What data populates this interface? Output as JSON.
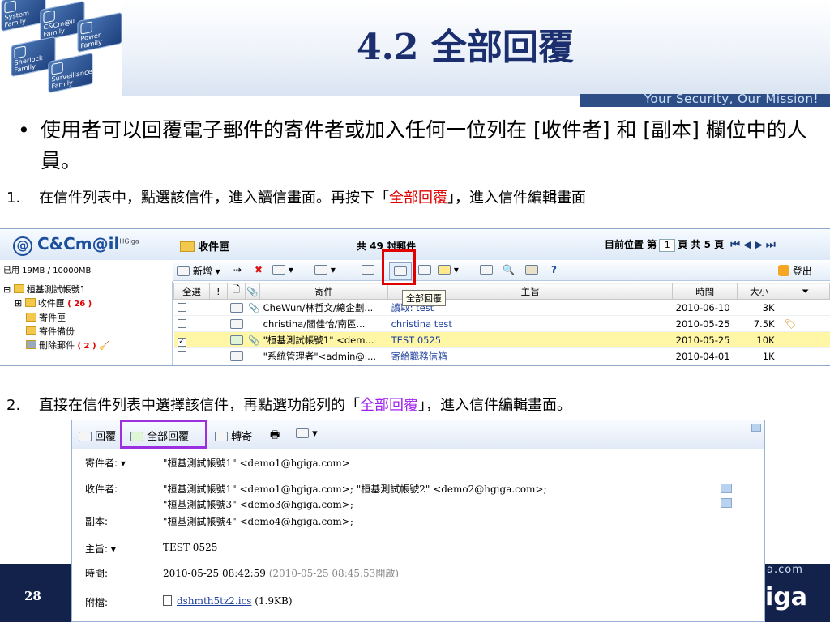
{
  "slide": {
    "title": "4.2 全部回覆",
    "slogan": "Your Security, Our Mission!",
    "bullet": "使用者可以回覆電子郵件的寄件者或加入任何一位列在 [收件者] 和 [副本] 欄位中的人員。",
    "step1": {
      "num": "1.",
      "pre": "在信件列表中，點選該信件，進入讀信畫面。再按下「",
      "accent": "全部回覆",
      "post": "」，進入信件編輯畫面"
    },
    "step2": {
      "num": "2.",
      "pre": "直接在信件列表中選擇該信件，再點選功能列的「",
      "accent": "全部回覆",
      "post": "」，進入信件編輯畫面。"
    },
    "page_number": "28",
    "footer_domain": "a.com",
    "footer_brand": "iga",
    "logo_tiles": [
      "System Family",
      "C&Cm@il Family",
      "Power Family",
      "Sherlock Family",
      "Surveillance Family"
    ]
  },
  "mail_list": {
    "brand": "C&Cm@il",
    "brand_sup": "HGiga",
    "folder": "收件匣",
    "count": "共 49 封郵件",
    "pager": {
      "label": "目前位置 第",
      "page": "1",
      "unit": "頁",
      "total": "共 5 頁"
    },
    "quota": "已用 19MB / 10000MB",
    "toolbar": {
      "new": "新增",
      "logout": "登出",
      "tooltip": "全部回覆"
    },
    "tree": [
      {
        "label": "桓基測試帳號1",
        "count": ""
      },
      {
        "label": "收件匣",
        "count": "( 26 )"
      },
      {
        "label": "寄件匣",
        "count": ""
      },
      {
        "label": "寄件備份",
        "count": ""
      },
      {
        "label": "刪除郵件",
        "count": "( 2 )"
      }
    ],
    "columns": {
      "select_all": "全選",
      "flag": "!",
      "sender": "寄件",
      "subject": "主旨",
      "time": "時間",
      "size": "大小"
    },
    "rows": [
      {
        "checked": false,
        "sender": "CheWun/林哲文/總企劃...",
        "subject": "讀取: test",
        "time": "2010-06-10",
        "size": "3K"
      },
      {
        "checked": false,
        "sender": "christina/閻佳怡/南區...",
        "subject": "christina test",
        "time": "2010-05-25",
        "size": "7.5K"
      },
      {
        "checked": true,
        "sender": "\"桓基測試帳號1\" <dem...",
        "subject": "TEST 0525",
        "time": "2010-05-25",
        "size": "10K"
      },
      {
        "checked": false,
        "sender": "\"系統管理者\"<admin@l...",
        "subject": "寄給職務信箱",
        "time": "2010-04-01",
        "size": "1K"
      }
    ]
  },
  "message": {
    "toolbar": {
      "reply": "回覆",
      "reply_all": "全部回覆",
      "forward": "轉寄"
    },
    "labels": {
      "from": "寄件者:",
      "to": "收件者:",
      "cc": "副本:",
      "subject": "主旨:",
      "time": "時間:",
      "attach": "附檔:"
    },
    "from": "\"桓基測試帳號1\" <demo1@hgiga.com>",
    "to_line1": "\"桓基測試帳號1\" <demo1@hgiga.com>; \"桓基測試帳號2\" <demo2@hgiga.com>;",
    "to_line2": "\"桓基測試帳號3\" <demo3@hgiga.com>;",
    "cc": "\"桓基測試帳號4\" <demo4@hgiga.com>;",
    "subject": "TEST 0525",
    "time": "2010-05-25 08:42:59",
    "time_read": "(2010-05-25 08:45:53開啟)",
    "attach_name": "dshmth5tz2.ics",
    "attach_size": "(1.9KB)"
  }
}
